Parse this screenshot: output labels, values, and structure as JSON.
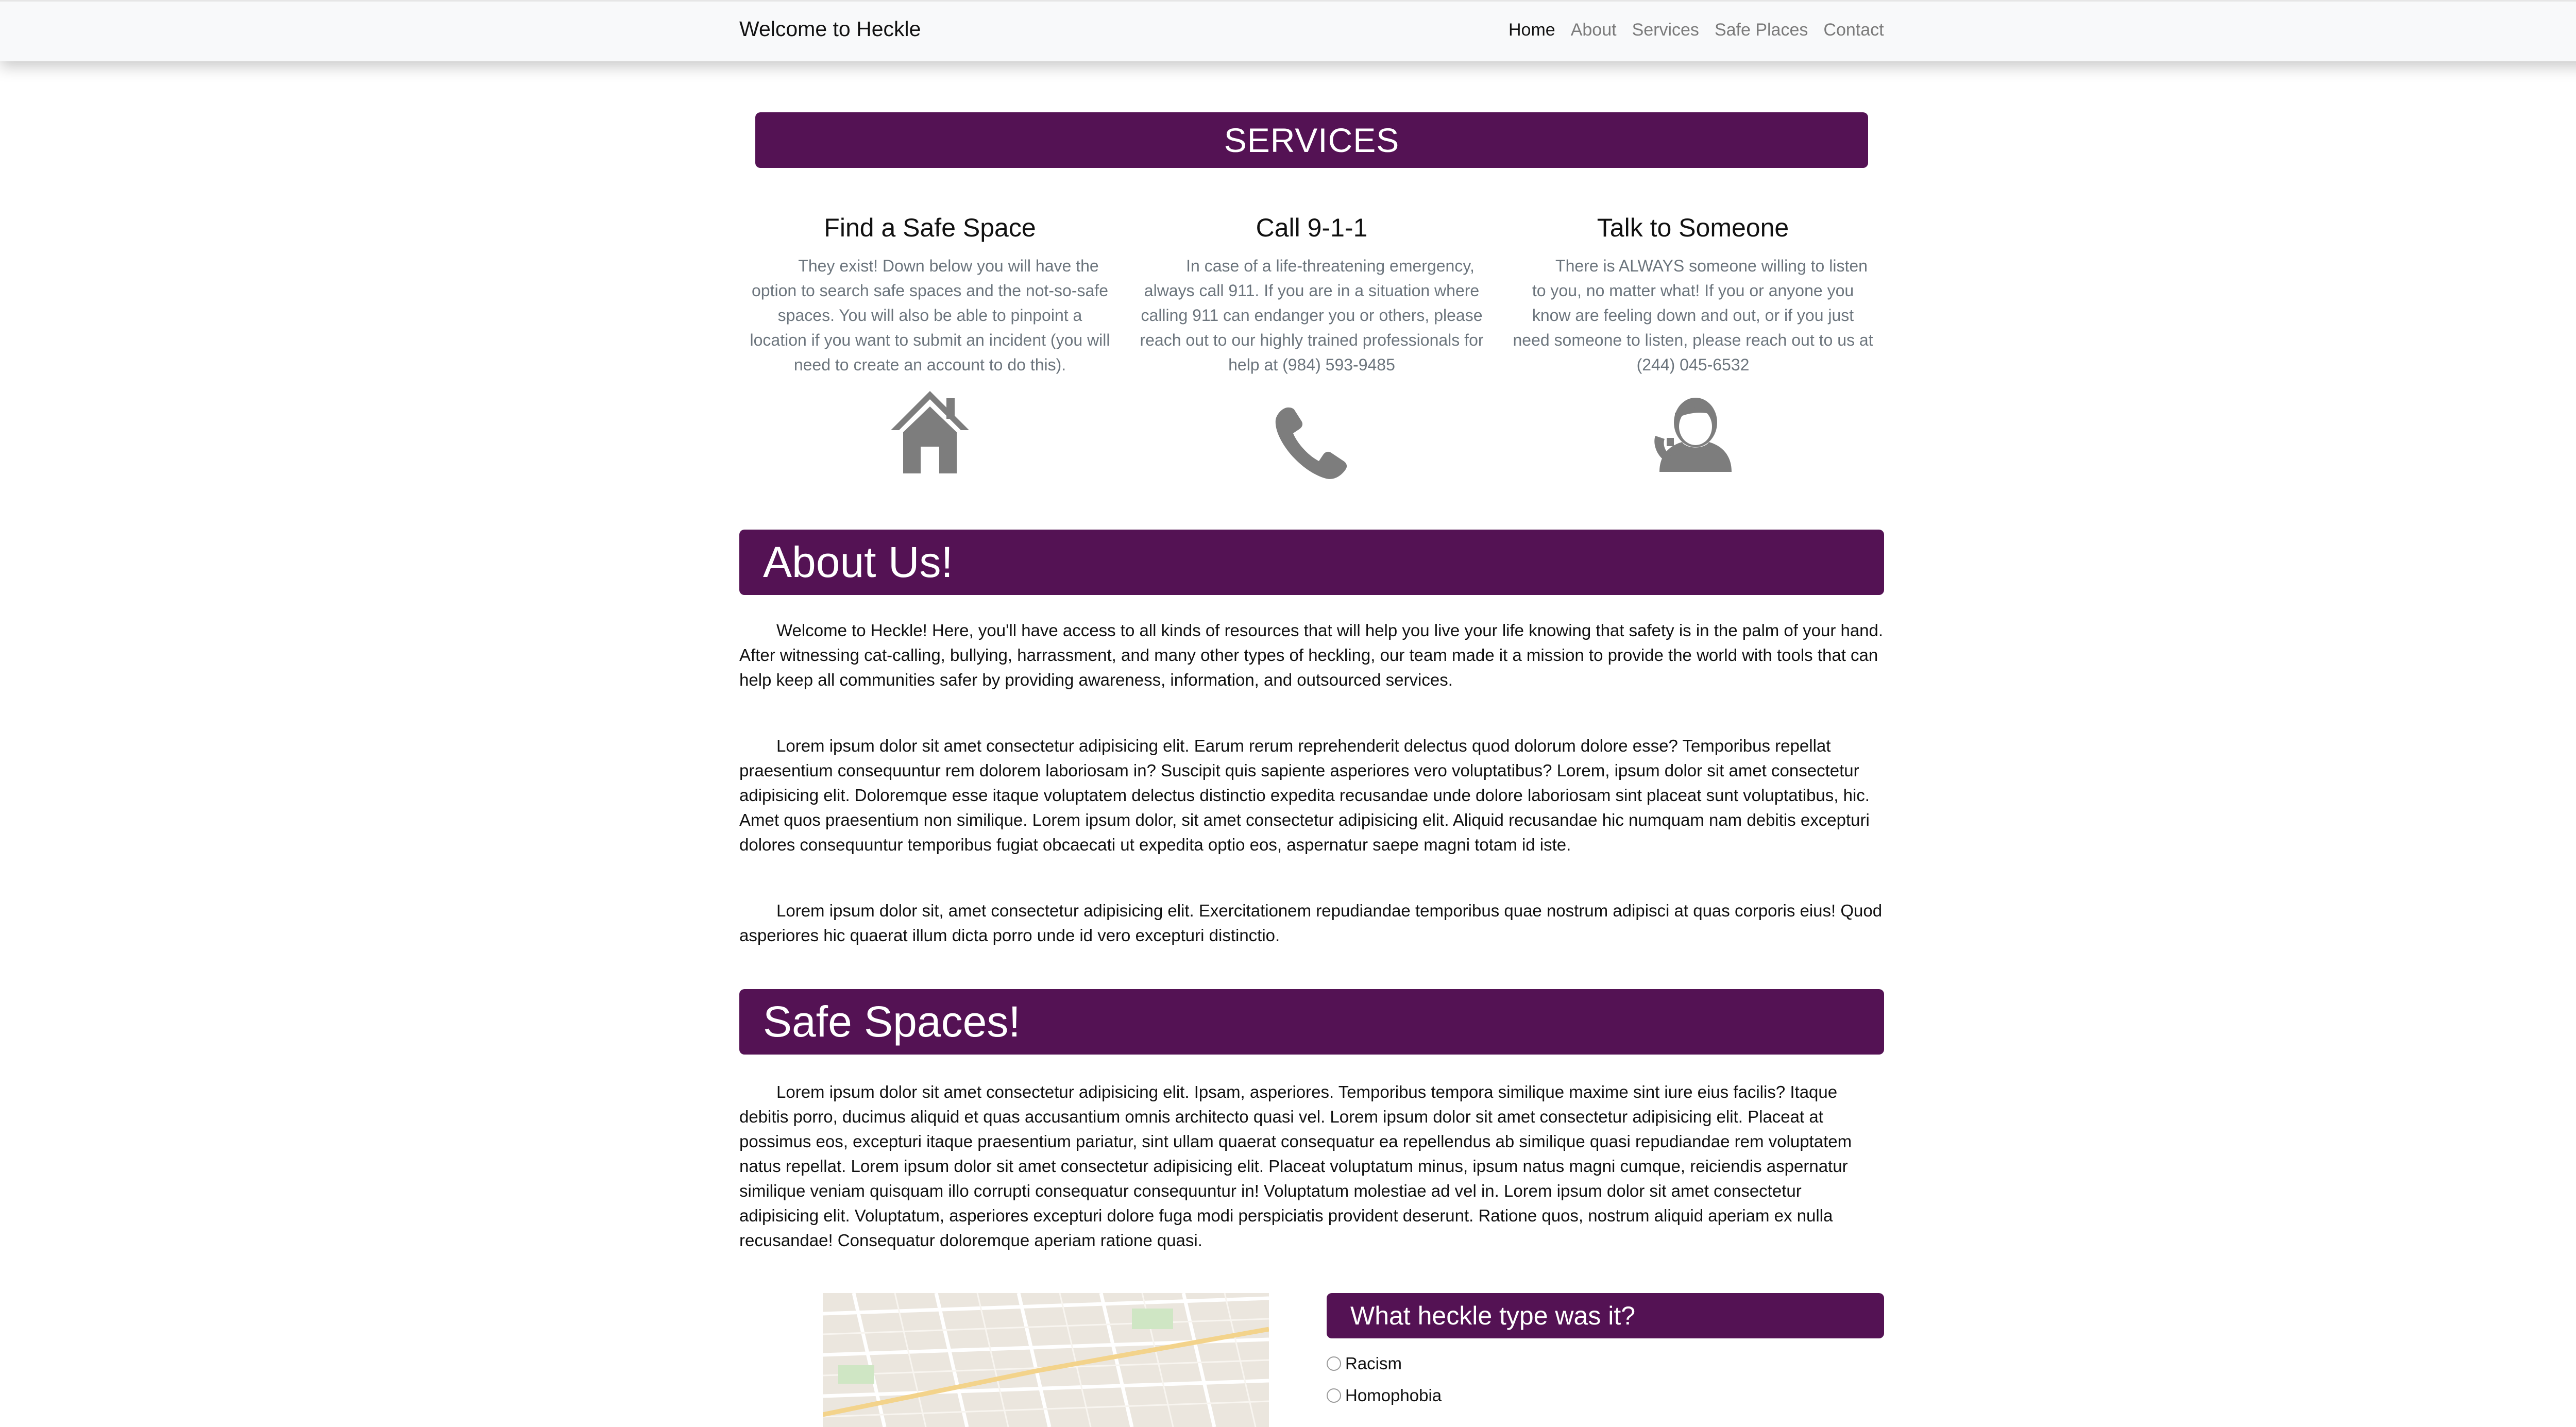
{
  "navbar": {
    "brand": "Welcome to Heckle",
    "links": [
      {
        "label": "Home",
        "active": true
      },
      {
        "label": "About",
        "active": false
      },
      {
        "label": "Services",
        "active": false
      },
      {
        "label": "Safe Places",
        "active": false
      },
      {
        "label": "Contact",
        "active": false
      }
    ]
  },
  "services": {
    "title": "SERVICES",
    "items": [
      {
        "title": "Find a Safe Space",
        "text": "They exist! Down below you will have the option to search safe spaces and the not-so-safe spaces. You will also be able to pinpoint a location if you want to submit an incident (you will need to create an account to do this).",
        "icon": "house-icon"
      },
      {
        "title": "Call 9-1-1",
        "text": "In case of a life-threatening emergency, always call 911. If you are in a situation where calling 911 can endanger you or others, please reach out to our highly trained professionals for help at (984) 593-9485",
        "icon": "phone-icon"
      },
      {
        "title": "Talk to Someone",
        "text": "There is ALWAYS someone willing to listen to you, no matter what! If you or anyone you know are feeling down and out, or if you just need someone to listen, please reach out to us at (244) 045-6532",
        "icon": "support-agent-icon"
      }
    ]
  },
  "about": {
    "title": "About Us!",
    "paragraphs": [
      "Welcome to Heckle! Here, you'll have access to all kinds of resources that will help you live your life knowing that safety is in the palm of your hand. After witnessing cat-calling, bullying, harrassment, and many other types of heckling, our team made it a mission to provide the world with tools that can help keep all communities safer by providing awareness, information, and outsourced services.",
      "Lorem ipsum dolor sit amet consectetur adipisicing elit. Earum rerum reprehenderit delectus quod dolorum dolore esse? Temporibus repellat praesentium consequuntur rem dolorem laboriosam in? Suscipit quis sapiente asperiores vero voluptatibus? Lorem, ipsum dolor sit amet consectetur adipisicing elit. Doloremque esse itaque voluptatem delectus distinctio expedita recusandae unde dolore laboriosam sint placeat sunt voluptatibus, hic. Amet quos praesentium non similique. Lorem ipsum dolor, sit amet consectetur adipisicing elit. Aliquid recusandae hic numquam nam debitis excepturi dolores consequuntur temporibus fugiat obcaecati ut expedita optio eos, aspernatur saepe magni totam id iste.",
      "Lorem ipsum dolor sit, amet consectetur adipisicing elit. Exercitationem repudiandae temporibus quae nostrum adipisci at quas corporis eius! Quod asperiores hic quaerat illum dicta porro unde id vero excepturi distinctio."
    ]
  },
  "safe_spaces": {
    "title": "Safe Spaces!",
    "paragraph": "Lorem ipsum dolor sit amet consectetur adipisicing elit. Ipsam, asperiores. Temporibus tempora similique maxime sint iure eius facilis? Itaque debitis porro, ducimus aliquid et quas accusantium omnis architecto quasi vel. Lorem ipsum dolor sit amet consectetur adipisicing elit. Placeat at possimus eos, excepturi itaque praesentium pariatur, sint ullam quaerat consequatur ea repellendus ab similique quasi repudiandae rem voluptatem natus repellat. Lorem ipsum dolor sit amet consectetur adipisicing elit. Placeat voluptatum minus, ipsum natus magni cumque, reiciendis aspernatur similique veniam quisquam illo corrupti consequatur consequuntur in! Voluptatum molestiae ad vel in. Lorem ipsum dolor sit amet consectetur adipisicing elit. Voluptatum, asperiores excepturi dolore fuga modi perspiciatis provident deserunt. Ratione quos, nostrum aliquid aperiam ex nulla recusandae! Consequatur doloremque aperiam ratione quasi."
  },
  "heckle_form": {
    "title": "What heckle type was it?",
    "options": [
      "Racism",
      "Homophobia"
    ]
  },
  "colors": {
    "accent": "#541254",
    "navbar_bg": "#f8f9fa",
    "muted_text": "#6c757d",
    "icon_gray": "#7d7d7d"
  }
}
